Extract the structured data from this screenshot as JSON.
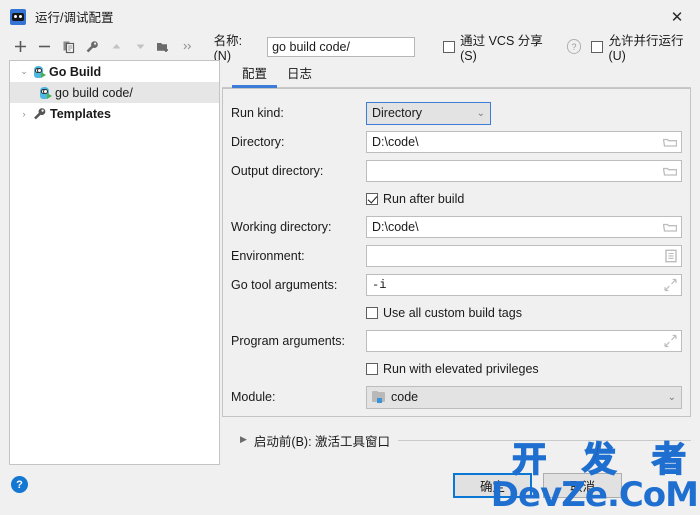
{
  "window": {
    "title": "运行/调试配置",
    "app_icon": "go-logo-icon",
    "close_label": "✕"
  },
  "toolbar": {
    "buttons": [
      {
        "name": "add-button",
        "glyph": "+"
      },
      {
        "name": "remove-button",
        "glyph": "−"
      },
      {
        "name": "copy-button",
        "glyph": "copy-icon"
      },
      {
        "name": "edit-templates-button",
        "glyph": "wrench-icon"
      },
      {
        "name": "move-up-button",
        "glyph": "▲"
      },
      {
        "name": "move-down-button",
        "glyph": "▼"
      },
      {
        "name": "move-into-folder-button",
        "glyph": "folder-add-icon"
      },
      {
        "name": "more-button",
        "glyph": "»"
      }
    ],
    "name_label": "名称:(N)",
    "name_value": "go build code/",
    "share_vcs_label": "通过 VCS 分享(S)",
    "share_vcs_checked": false,
    "help_glyph": "?",
    "allow_parallel_label": "允许并行运行(U)",
    "allow_parallel_checked": false
  },
  "tree": {
    "items": [
      {
        "label": "Go Build",
        "arrow": "⌄",
        "icon": "go-build-icon",
        "bold": true,
        "selected": false,
        "indent": 0
      },
      {
        "label": "go build code/",
        "arrow": "",
        "icon": "go-build-icon",
        "bold": false,
        "selected": true,
        "indent": 1
      },
      {
        "label": "Templates",
        "arrow": "›",
        "icon": "wrench-icon",
        "bold": true,
        "selected": false,
        "indent": 0
      }
    ]
  },
  "tabs": [
    {
      "label": "配置",
      "active": true
    },
    {
      "label": "日志",
      "active": false
    }
  ],
  "form": {
    "run_kind_label": "Run kind:",
    "run_kind_value": "Directory",
    "directory_label": "Directory:",
    "directory_value": "D:\\code\\",
    "output_directory_label": "Output directory:",
    "output_directory_value": "",
    "run_after_build_label": "Run after build",
    "run_after_build_checked": true,
    "working_directory_label": "Working directory:",
    "working_directory_value": "D:\\code\\",
    "environment_label": "Environment:",
    "environment_value": "",
    "go_tool_arguments_label": "Go tool arguments:",
    "go_tool_arguments_value": "-i",
    "use_all_custom_build_tags_label": "Use all custom build tags",
    "use_all_custom_build_tags_checked": false,
    "program_arguments_label": "Program arguments:",
    "program_arguments_value": "",
    "run_elevated_label": "Run with elevated privileges",
    "run_elevated_checked": false,
    "module_label": "Module:",
    "module_value": "code"
  },
  "before_launch": {
    "arrow": "▶",
    "text": "启动前(B): 激活工具窗口"
  },
  "footer": {
    "help_glyph": "?",
    "ok_label": "确定",
    "cancel_label": "取消"
  },
  "watermark": {
    "line1": "开 发 者",
    "line2": "DevZe.CoM"
  },
  "colors": {
    "accent": "#3b7dd8",
    "window_bg": "#f0f0f0",
    "panel_bg": "#ffffff",
    "selection": "#e6e6e6",
    "watermark_blue": "#1f6fd0"
  }
}
